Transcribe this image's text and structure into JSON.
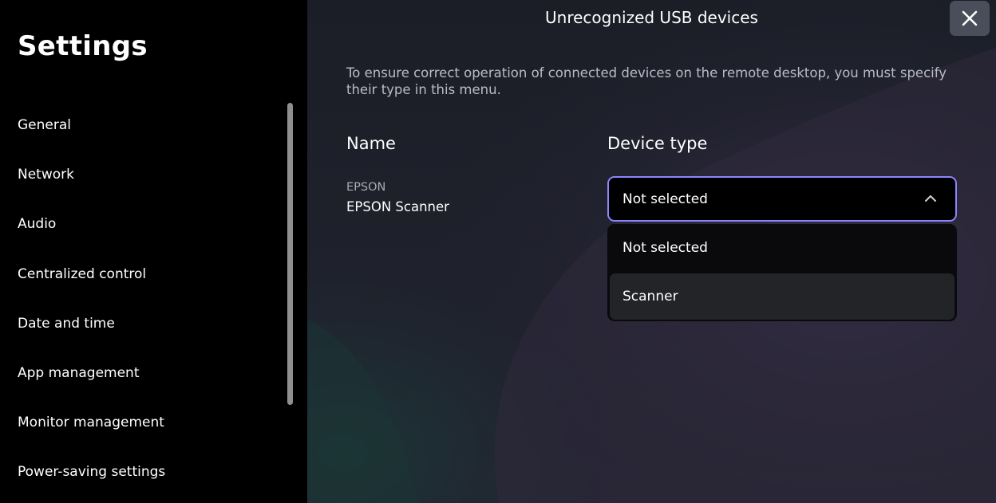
{
  "sidebar": {
    "title": "Settings",
    "items": [
      {
        "label": "General"
      },
      {
        "label": "Network"
      },
      {
        "label": "Audio"
      },
      {
        "label": "Centralized control"
      },
      {
        "label": "Date and time"
      },
      {
        "label": "App management"
      },
      {
        "label": "Monitor management"
      },
      {
        "label": "Power-saving settings"
      }
    ]
  },
  "dialog": {
    "title": "Unrecognized USB devices",
    "description": "To ensure correct operation of connected devices on the remote desktop, you must specify their type in this menu.",
    "columns": {
      "name": "Name",
      "device_type": "Device type"
    },
    "devices": [
      {
        "vendor": "EPSON",
        "model": "EPSON Scanner",
        "selected_type": "Not selected"
      }
    ],
    "dropdown": {
      "expanded": true,
      "options": [
        "Not selected",
        "Scanner"
      ],
      "hovered_option": "Scanner"
    }
  },
  "icons": {
    "close": "close-icon",
    "chevron": "chevron-up-icon"
  },
  "colors": {
    "accent_border": "#8d84ff",
    "sidebar_bg": "#000000",
    "panel_bg": "#1f222d",
    "close_button_bg": "#4a4e5a"
  }
}
